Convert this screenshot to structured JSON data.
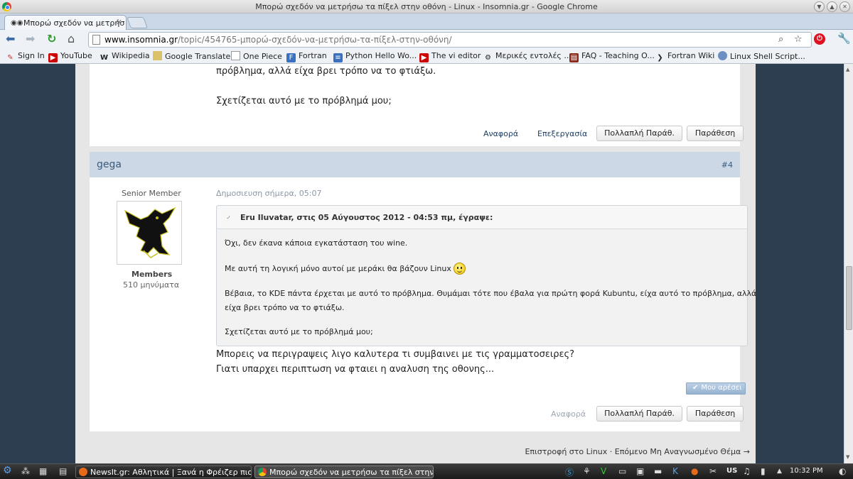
{
  "window": {
    "title": "Μπορώ σχεδόν να μετρήσω τα πίξελ στην οθόνη - Linux - Insomnia.gr - Google Chrome"
  },
  "tab": {
    "label": "Μπορώ σχεδόν να μετρήσ"
  },
  "address": {
    "host": "www.insomnia.gr",
    "path": "/topic/454765-μπορώ-σχεδόν-να-μετρήσω-τα-πίξελ-στην-οθόνη/"
  },
  "bookmarks": [
    {
      "label": "Sign In",
      "icon": "sign-in-icon"
    },
    {
      "label": "YouTube",
      "icon": "youtube-icon"
    },
    {
      "label": "Wikipedia",
      "icon": "wikipedia-icon"
    },
    {
      "label": "Google Translate",
      "icon": "translate-icon"
    },
    {
      "label": "One Piece",
      "icon": "page-icon"
    },
    {
      "label": "Fortran",
      "icon": "fortran-icon"
    },
    {
      "label": "Python Hello Wo...",
      "icon": "python-icon"
    },
    {
      "label": "The vi editor",
      "icon": "youtube-icon"
    },
    {
      "label": "Μερικές εντολές ...",
      "icon": "gear-icon"
    },
    {
      "label": "FAQ - Teaching O...",
      "icon": "book-icon"
    },
    {
      "label": "Fortran Wiki",
      "icon": "wiki-icon"
    },
    {
      "label": "Linux Shell Script...",
      "icon": "globe-icon"
    }
  ],
  "prev_post": {
    "text_line1": "πρόβλημα, αλλά είχα βρει τρόπο να το φτιάξω.",
    "text_line2": "Σχετίζεται αυτό με το πρόβλημά μου;",
    "report": "Αναφορά",
    "edit": "Επεξεργασία",
    "multiquote": "Πολλαπλή Παράθ.",
    "quote": "Παράθεση"
  },
  "post": {
    "author": "gega",
    "number": "#4",
    "rank": "Senior Member",
    "group": "Members",
    "post_count": "510 μηνύματα",
    "date": "Δημοσιευση σήμερα, 05:07",
    "quote_header": "Eru Iluvatar, στις 05 Αύγουστος 2012 - 04:53 πμ, έγραψε:",
    "quote_lines": [
      "Όχι, δεν έκανα κάποια εγκατάσταση του wine.",
      "Με αυτή τη λογική μόνο αυτοί με μεράκι θα βάζουν Linux",
      "Βέβαια, το KDE πάντα έρχεται με αυτό το πρόβλημα. Θυμάμαι τότε που έβαλα για πρώτη φορά Kubuntu, είχα αυτό το πρόβλημα, αλλά",
      "είχα βρει τρόπο να το φτιάξω.",
      "Σχετίζεται αυτό με το πρόβλημά μου;"
    ],
    "reply_line1": "Μπορεις να περιγραψεις λιγο καλυτερα τι συμβαινει με τις γραμματοσειρες?",
    "reply_line2": "Γιατι υπαρχει περιπτωση να φταιει η αναλυση της οθονης...",
    "like": "Μου αρέσει",
    "report": "Αναφορά",
    "multiquote": "Πολλαπλή Παράθ.",
    "quote": "Παράθεση"
  },
  "footer": {
    "back": "Επιστροφή στο Linux",
    "separator": "·",
    "next": "Επόμενο Μη Αναγνωσμένο Θέμα →"
  },
  "taskbar": {
    "tasks": [
      {
        "label": "NewsIt.gr: Αθλητικά | Ξανά η Φρέιζερ πιο γρήγο"
      },
      {
        "label": "Μπορώ σχεδόν να μετρήσω τα πίξελ στην οθόνη"
      }
    ],
    "keyboard": "US",
    "clock": "10:32 PM"
  }
}
